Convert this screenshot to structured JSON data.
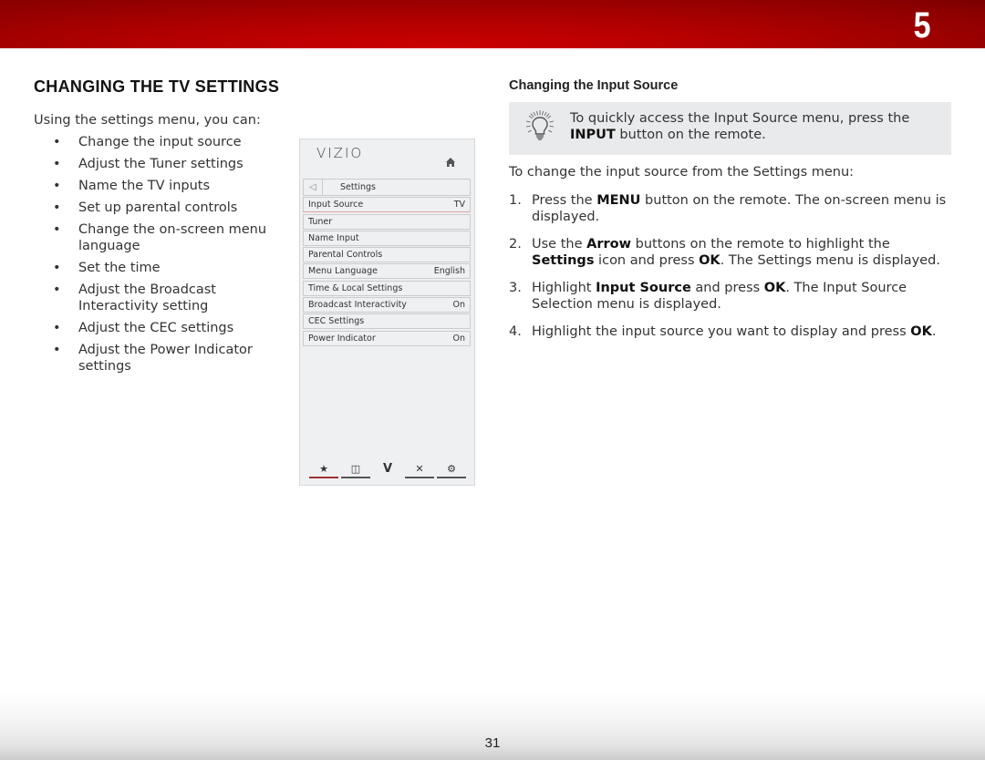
{
  "header": {
    "chapter_number": "5"
  },
  "footer": {
    "page_number": "31"
  },
  "left": {
    "title": "CHANGING THE TV SETTINGS",
    "intro": "Using the settings menu, you can:",
    "bullets": [
      "Change the input source",
      "Adjust the Tuner settings",
      "Name the TV inputs",
      "Set up parental controls",
      "Change the on-screen menu language",
      "Set the time",
      "Adjust the Broadcast Interactivity setting",
      "Adjust the CEC settings",
      "Adjust the Power Indicator settings"
    ],
    "bullet_char": "•"
  },
  "tv_menu": {
    "logo": "VIZIO",
    "home_icon": "home-icon",
    "back_icon": "◁",
    "header_label": "Settings",
    "rows": [
      {
        "label": "Input Source",
        "value": "TV"
      },
      {
        "label": "Tuner",
        "value": ""
      },
      {
        "label": "Name Input",
        "value": ""
      },
      {
        "label": "Parental Controls",
        "value": ""
      },
      {
        "label": "Menu Language",
        "value": "English"
      },
      {
        "label": "Time & Local Settings",
        "value": ""
      },
      {
        "label": "Broadcast Interactivity",
        "value": "On"
      },
      {
        "label": "CEC Settings",
        "value": ""
      },
      {
        "label": "Power Indicator",
        "value": "On"
      }
    ],
    "bottom_bar": [
      {
        "icon": "star-icon",
        "glyph": "★"
      },
      {
        "icon": "picture-in-picture-icon",
        "glyph": "◫"
      },
      {
        "icon": "vizio-v-icon",
        "glyph": "V"
      },
      {
        "icon": "close-icon",
        "glyph": "✕"
      },
      {
        "icon": "gear-icon",
        "glyph": "⚙"
      }
    ],
    "accent_color": "#a03030"
  },
  "right": {
    "section_title": "Changing the Input Source",
    "tip": {
      "icon": "lightbulb-icon",
      "text_before": "To quickly access the Input Source menu, press the ",
      "bold": "INPUT",
      "text_after": " button on the remote."
    },
    "lead": "To change the input source from the Settings menu:",
    "steps": [
      {
        "num": "1.",
        "parts": [
          {
            "t": "Press the "
          },
          {
            "b": "MENU"
          },
          {
            "t": " button on the remote. The on-screen menu is displayed."
          }
        ]
      },
      {
        "num": "2.",
        "parts": [
          {
            "t": "Use the "
          },
          {
            "b": "Arrow"
          },
          {
            "t": " buttons on the remote to highlight the "
          },
          {
            "b": "Settings"
          },
          {
            "t": " icon and press "
          },
          {
            "b": "OK"
          },
          {
            "t": ". The Settings menu is displayed."
          }
        ]
      },
      {
        "num": "3.",
        "parts": [
          {
            "t": "Highlight "
          },
          {
            "b": "Input Source"
          },
          {
            "t": " and press "
          },
          {
            "b": "OK"
          },
          {
            "t": ". The Input Source Selection menu is displayed."
          }
        ]
      },
      {
        "num": "4.",
        "parts": [
          {
            "t": "Highlight the input source you want to display and press "
          },
          {
            "b": "OK"
          },
          {
            "t": "."
          }
        ]
      }
    ]
  },
  "colors": {
    "header_red": "#c00000",
    "tip_bg": "#e9eaeb",
    "panel_bg": "#eef0f1"
  }
}
